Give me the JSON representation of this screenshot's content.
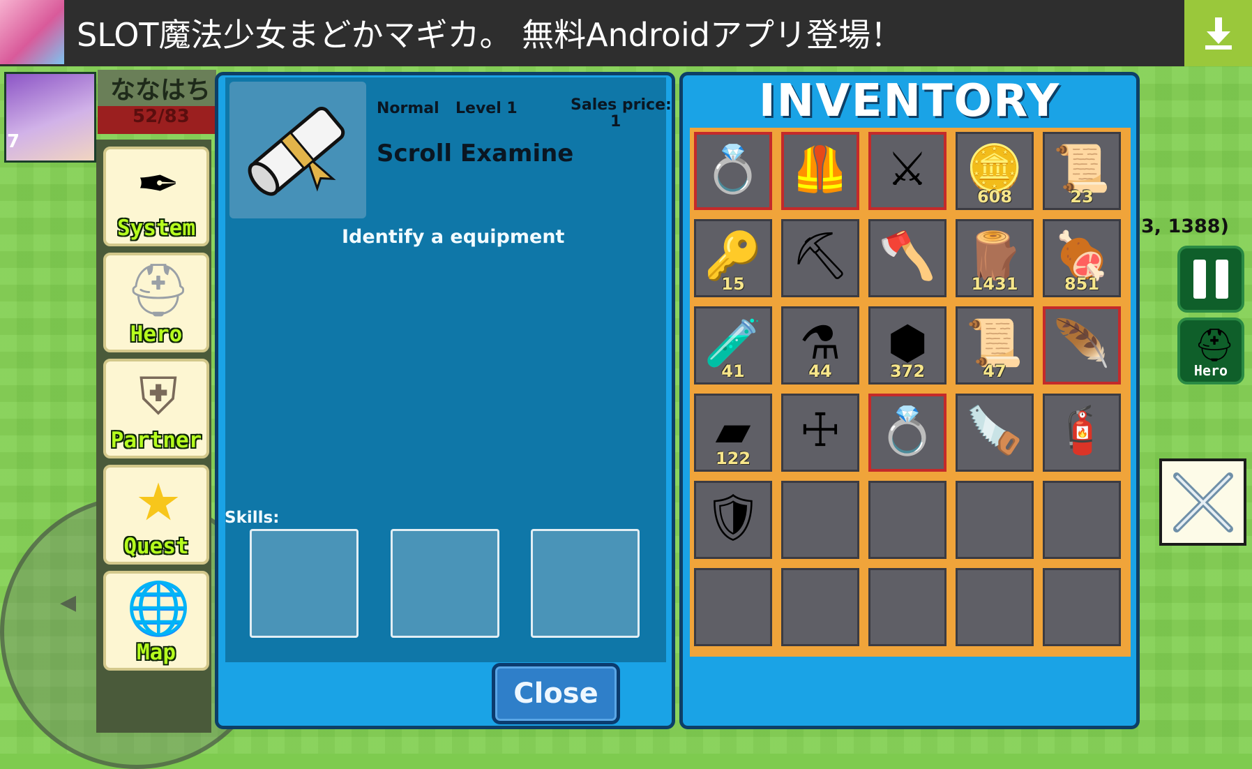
{
  "ad": {
    "text": "SLOT魔法少女まどかマギカ。 無料Androidアプリ登場！",
    "download_icon": "download-icon",
    "accent_color": "#9ac83b"
  },
  "player": {
    "level": "7",
    "name": "ななはち",
    "hp_text": "52/83"
  },
  "menu": [
    {
      "label": "System",
      "icon": "quill-potion-icon"
    },
    {
      "label": "Hero",
      "icon": "knight-helmet-icon"
    },
    {
      "label": "Partner",
      "icon": "partner-armor-icon"
    },
    {
      "label": "Quest",
      "icon": "star-icon"
    },
    {
      "label": "Map",
      "icon": "globe-icon"
    }
  ],
  "detail": {
    "rarity": "Normal",
    "level": "Level 1",
    "sales_label": "Sales price:",
    "sales_value": "1",
    "item_name": "Scroll Examine",
    "description": "Identify a equipment",
    "skills_label": "Skills:",
    "close_label": "Close"
  },
  "inventory": {
    "title": "INVENTORY",
    "slots": [
      {
        "icon": "gold-ring-icon",
        "count": "",
        "equipped": true
      },
      {
        "icon": "leather-armor-icon",
        "count": "",
        "equipped": true
      },
      {
        "icon": "crossed-swords-icon",
        "count": "",
        "equipped": true
      },
      {
        "icon": "gold-coins-icon",
        "count": "608",
        "equipped": false
      },
      {
        "icon": "scroll-icon",
        "count": "23",
        "equipped": false
      },
      {
        "icon": "gold-key-icon",
        "count": "15",
        "equipped": false
      },
      {
        "icon": "pickaxe-icon",
        "count": "",
        "equipped": false
      },
      {
        "icon": "axe-icon",
        "count": "",
        "equipped": false
      },
      {
        "icon": "wood-logs-icon",
        "count": "1431",
        "equipped": false
      },
      {
        "icon": "raw-meat-icon",
        "count": "851",
        "equipped": false
      },
      {
        "icon": "red-vial-icon",
        "count": "41",
        "equipped": false
      },
      {
        "icon": "red-flask-icon",
        "count": "44",
        "equipped": false
      },
      {
        "icon": "silver-ore-icon",
        "count": "372",
        "equipped": false
      },
      {
        "icon": "blue-scroll-icon",
        "count": "47",
        "equipped": false
      },
      {
        "icon": "feather-charm-icon",
        "count": "",
        "equipped": true
      },
      {
        "icon": "silver-ingot-icon",
        "count": "122",
        "equipped": false
      },
      {
        "icon": "golden-staff-icon",
        "count": "",
        "equipped": false
      },
      {
        "icon": "gold-ring-icon",
        "count": "",
        "equipped": true
      },
      {
        "icon": "chainsaw-icon",
        "count": "",
        "equipped": false
      },
      {
        "icon": "fire-extinguisher-icon",
        "count": "",
        "equipped": false
      },
      {
        "icon": "plate-armor-icon",
        "count": "",
        "equipped": false
      },
      {
        "icon": "",
        "count": "",
        "equipped": false
      },
      {
        "icon": "",
        "count": "",
        "equipped": false
      },
      {
        "icon": "",
        "count": "",
        "equipped": false
      },
      {
        "icon": "",
        "count": "",
        "equipped": false
      },
      {
        "icon": "",
        "count": "",
        "equipped": false
      },
      {
        "icon": "",
        "count": "",
        "equipped": false
      },
      {
        "icon": "",
        "count": "",
        "equipped": false
      },
      {
        "icon": "",
        "count": "",
        "equipped": false
      },
      {
        "icon": "",
        "count": "",
        "equipped": false
      }
    ]
  },
  "hud": {
    "coords": "3, 1388)",
    "hero_label": "Hero",
    "pause_icon": "pause-icon",
    "attack_icon": "crossed-swords-icon"
  }
}
